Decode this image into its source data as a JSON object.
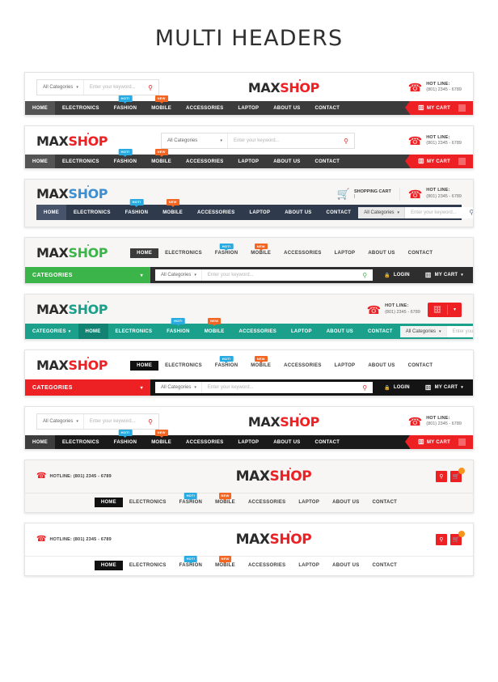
{
  "page": {
    "title": "MULTI HEADERS"
  },
  "brand": {
    "part1": "MAX",
    "part2": "SHOP"
  },
  "search": {
    "category_label": "All Categories",
    "placeholder": "Enter your keyword...",
    "caret": "▾",
    "icon": "search-icon"
  },
  "hotline": {
    "label": "HOT LINE:",
    "number": "(801) 2345 - 6789",
    "inline": "HOTLINE: (801) 2345 - 6789",
    "icon": "telephone-icon"
  },
  "shopping_cart": {
    "label": "SHOPPING CART",
    "value": "|",
    "icon": "cart-icon"
  },
  "cart_button": {
    "label": "MY CART",
    "icon": "basket-icon",
    "caret": "⌵"
  },
  "login_button": {
    "label": "LOGIN",
    "icon": "lock-icon"
  },
  "categories_button": {
    "label": "CATEGORIES",
    "caret": "⌵"
  },
  "nav": {
    "items": [
      {
        "label": "HOME",
        "badge": null
      },
      {
        "label": "ELECTRONICS",
        "badge": null
      },
      {
        "label": "FASHION",
        "badge": "HOT!",
        "badge_type": "hot"
      },
      {
        "label": "MOBILE",
        "badge": "NEW",
        "badge_type": "new"
      },
      {
        "label": "ACCESSORIES",
        "badge": null
      },
      {
        "label": "LAPTOP",
        "badge": null
      },
      {
        "label": "ABOUT US",
        "badge": null
      },
      {
        "label": "CONTACT",
        "badge": null
      }
    ]
  },
  "colors": {
    "red": "#ed2024",
    "blue": "#3d8fd1",
    "green": "#3bb54a",
    "teal": "#1aa08b",
    "dark_nav": "#3b3b3b",
    "black_nav": "#1a1a1a",
    "navy_nav": "#2f3b4d",
    "badge_hot": "#29abe2",
    "badge_new": "#f26522",
    "orange_dot": "#f7941e"
  },
  "headers": [
    {
      "id": 1,
      "variant": "search-left-dark-nav",
      "accent": "red"
    },
    {
      "id": 2,
      "variant": "logo-left-dark-nav",
      "accent": "red"
    },
    {
      "id": 3,
      "variant": "navy-nav-search-right",
      "accent": "blue"
    },
    {
      "id": 4,
      "variant": "green-categories",
      "accent": "green"
    },
    {
      "id": 5,
      "variant": "teal-fullbar",
      "accent": "teal"
    },
    {
      "id": 6,
      "variant": "red-categories",
      "accent": "red"
    },
    {
      "id": 7,
      "variant": "search-left-black-nav",
      "accent": "red"
    },
    {
      "id": 8,
      "variant": "hotline-top-centered",
      "accent": "red"
    },
    {
      "id": 9,
      "variant": "hotline-top-centered-2",
      "accent": "red"
    }
  ]
}
